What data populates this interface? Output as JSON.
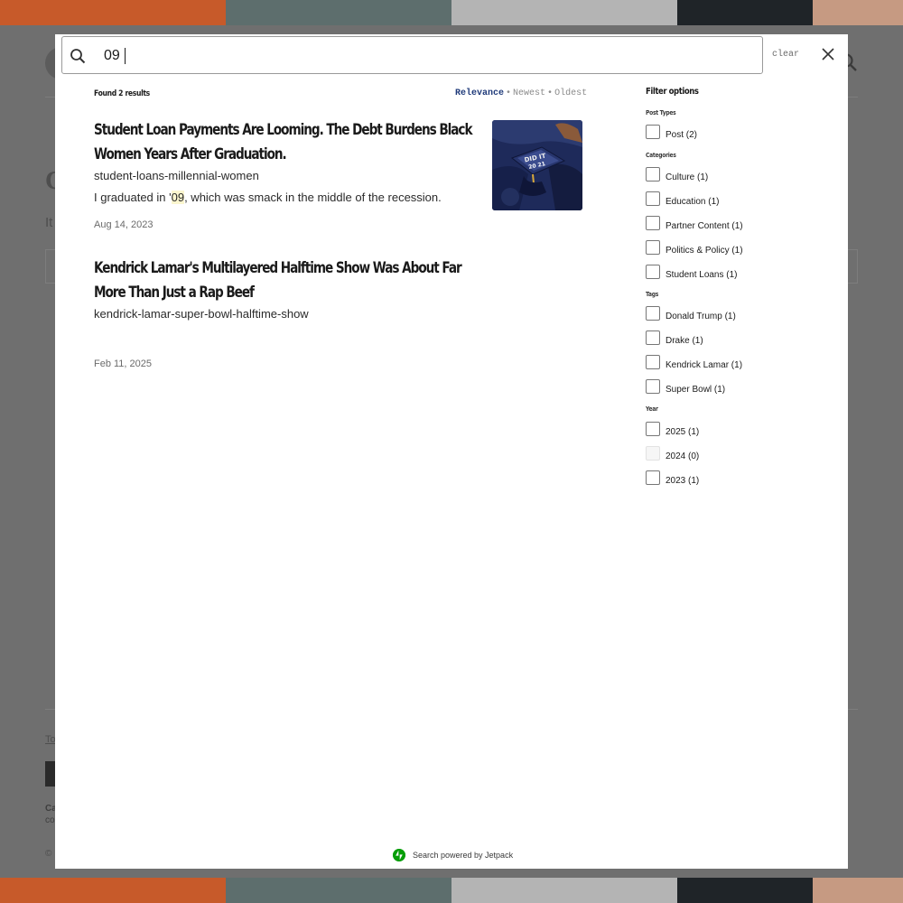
{
  "colors": {
    "stripe_orange": "#c75a2a",
    "stripe_teal": "#5d6e6d",
    "stripe_gray": "#b4b4b4",
    "stripe_dark": "#1f2428",
    "stripe_tan": "#c69a82",
    "sort_active": "#1f3a7a",
    "highlight": "#fbf6cf",
    "jetpack_green": "#069e08"
  },
  "search": {
    "query": "09",
    "clear_label": "clear"
  },
  "results_header": {
    "found_text": "Found 2 results",
    "sort_options": [
      "Relevance",
      "Newest",
      "Oldest"
    ],
    "sort_separator": "•",
    "active_sort": "Relevance"
  },
  "results": [
    {
      "title": "Student Loan Payments Are Looming. The Debt Burdens Black Women Years After Graduation.",
      "slug": "student-loans-millennial-women",
      "excerpt_before": "I graduated in '",
      "excerpt_highlight": "09",
      "excerpt_after": ", which was smack in the middle of the recession.",
      "date": "Aug 14, 2023",
      "thumbnail_icon": "graduation-cap-photo"
    },
    {
      "title": "Kendrick Lamar's Multilayered Halftime Show Was About Far More Than Just a Rap Beef",
      "slug": "kendrick-lamar-super-bowl-halftime-show",
      "date": "Feb 11, 2025"
    }
  ],
  "filters": {
    "title": "Filter options",
    "groups": [
      {
        "label": "Post Types",
        "items": [
          {
            "label": "Post (2)"
          }
        ]
      },
      {
        "label": "Categories",
        "items": [
          {
            "label": "Culture (1)"
          },
          {
            "label": "Education (1)"
          },
          {
            "label": "Partner Content (1)"
          },
          {
            "label": "Politics & Policy (1)"
          },
          {
            "label": "Student Loans (1)"
          }
        ]
      },
      {
        "label": "Tags",
        "items": [
          {
            "label": "Donald Trump (1)"
          },
          {
            "label": "Drake (1)"
          },
          {
            "label": "Kendrick Lamar (1)"
          },
          {
            "label": "Super Bowl (1)"
          }
        ]
      },
      {
        "label": "Year",
        "items": [
          {
            "label": "2025 (1)"
          },
          {
            "label": "2024 (0)",
            "disabled": true
          },
          {
            "label": "2023 (1)"
          }
        ]
      }
    ]
  },
  "footer": {
    "powered_by": "Search powered by Jetpack",
    "icon": "jetpack-icon"
  }
}
